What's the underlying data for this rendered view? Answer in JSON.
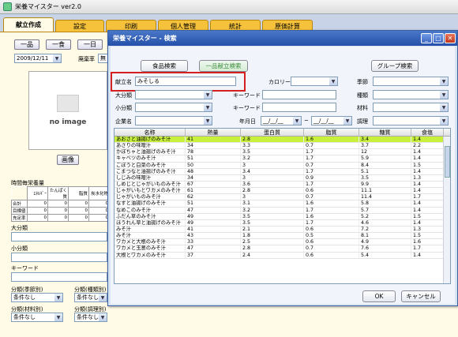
{
  "app": {
    "title": "栄養マイスター ver2.0"
  },
  "tabs": [
    {
      "label": "献立作成"
    },
    {
      "label": "設定"
    },
    {
      "label": "印刷"
    },
    {
      "label": "個人管理"
    },
    {
      "label": "統計"
    },
    {
      "label": "原価計算"
    }
  ],
  "left": {
    "btn_hin": "一品",
    "btn_shoku": "一食",
    "btn_day": "一日",
    "date": "2009/12/11",
    "menu_label": "献立",
    "meal_label": "廃棄率",
    "meal_value": "無",
    "noimage": "no image",
    "image_btn": "画像",
    "nutrition_title": "時間毎栄養量",
    "nut_cols": [
      "ｴﾈﾙｷﾞｰ",
      "たんぱく質",
      "脂質",
      "炭水化物"
    ],
    "nut_rows": [
      {
        "label": "合計",
        "vals": [
          "0",
          "0",
          "0",
          "0"
        ]
      },
      {
        "label": "目標値",
        "vals": [
          "0",
          "0",
          "0",
          "0"
        ]
      },
      {
        "label": "充足率",
        "vals": [
          "0",
          "0",
          "0",
          "0"
        ]
      }
    ],
    "large_cat": "大分類",
    "small_cat": "小分類",
    "keyword": "キーワード",
    "f1": "分類(季節別)",
    "f2": "分類(種類別)",
    "f3": "分類(材料別)",
    "f4": "分類(調理別)",
    "none": "条件なし"
  },
  "dialog": {
    "title": "栄養マイスター - 検索",
    "btn_food": "食品検索",
    "btn_dish": "一品献立検索",
    "btn_group": "グループ検索",
    "name_label": "献立名",
    "name_value": "みそしる",
    "calorie": "カロリー",
    "season": "季節",
    "large_cat": "大分類",
    "keyword": "キーワード",
    "kind": "種類",
    "small_cat": "小分類",
    "material": "材料",
    "company": "企業名",
    "date_label": "年月日",
    "date_from": "__/__/__",
    "tilde": "~",
    "date_to": "__/__/__",
    "cook": "調理",
    "ok": "OK",
    "cancel": "キャンセル",
    "columns": [
      "名称",
      "熱量",
      "蛋白質",
      "脂質",
      "糖質",
      "食塩"
    ],
    "rows": [
      [
        "あおさと油揚げのみそ汁",
        "41",
        "2.8",
        "1.6",
        "3.4",
        "1.4"
      ],
      [
        "あさりの味噌汁",
        "34",
        "3.3",
        "0.7",
        "3.7",
        "2.2"
      ],
      [
        "かぼちゃと油揚げのみそ汁",
        "78",
        "3.5",
        "1.7",
        "12",
        "1.4"
      ],
      [
        "キャベツのみそ汁",
        "51",
        "3.2",
        "1.7",
        "5.9",
        "1.4"
      ],
      [
        "ごぼうと白菜のみそ汁",
        "50",
        "3",
        "0.7",
        "8.4",
        "1.5"
      ],
      [
        "こまつなと油揚げのみそ汁",
        "48",
        "3.4",
        "1.7",
        "5.1",
        "1.4"
      ],
      [
        "しじみの味噌汁",
        "34",
        "3",
        "0.9",
        "3.5",
        "1.3"
      ],
      [
        "しめじとじゃがいものみそ汁",
        "67",
        "3.6",
        "1.7",
        "9.9",
        "1.4"
      ],
      [
        "じゃがいもとワカメのみそ汁",
        "61",
        "2.8",
        "0.6",
        "11.1",
        "1.4"
      ],
      [
        "じゃがいものみそ汁",
        "62",
        "3",
        "0.7",
        "11.4",
        "1.7"
      ],
      [
        "なすと油揚げのみそ汁",
        "51",
        "3.1",
        "1.6",
        "5.8",
        "1.4"
      ],
      [
        "なめこのみそ汁",
        "47",
        "3.2",
        "1.7",
        "5.7",
        "1.4"
      ],
      [
        "ふだん草のみそ汁",
        "49",
        "3.5",
        "1.6",
        "5.2",
        "1.5"
      ],
      [
        "ほうれん草と油揚げのみそ汁",
        "49",
        "3.5",
        "1.7",
        "4.6",
        "1.4"
      ],
      [
        "みそ汁",
        "41",
        "2.1",
        "0.6",
        "7.2",
        "1.3"
      ],
      [
        "みそ汁",
        "43",
        "1.8",
        "0.5",
        "8.1",
        "1.5"
      ],
      [
        "ワカメと大根のみそ汁",
        "33",
        "2.5",
        "0.6",
        "4.9",
        "1.6"
      ],
      [
        "ワカメと玉葱のみそ汁",
        "47",
        "2.8",
        "0.7",
        "7.6",
        "1.7"
      ],
      [
        "大根とワカメのみそ汁",
        "37",
        "2.4",
        "0.6",
        "5.4",
        "1.4"
      ]
    ]
  }
}
